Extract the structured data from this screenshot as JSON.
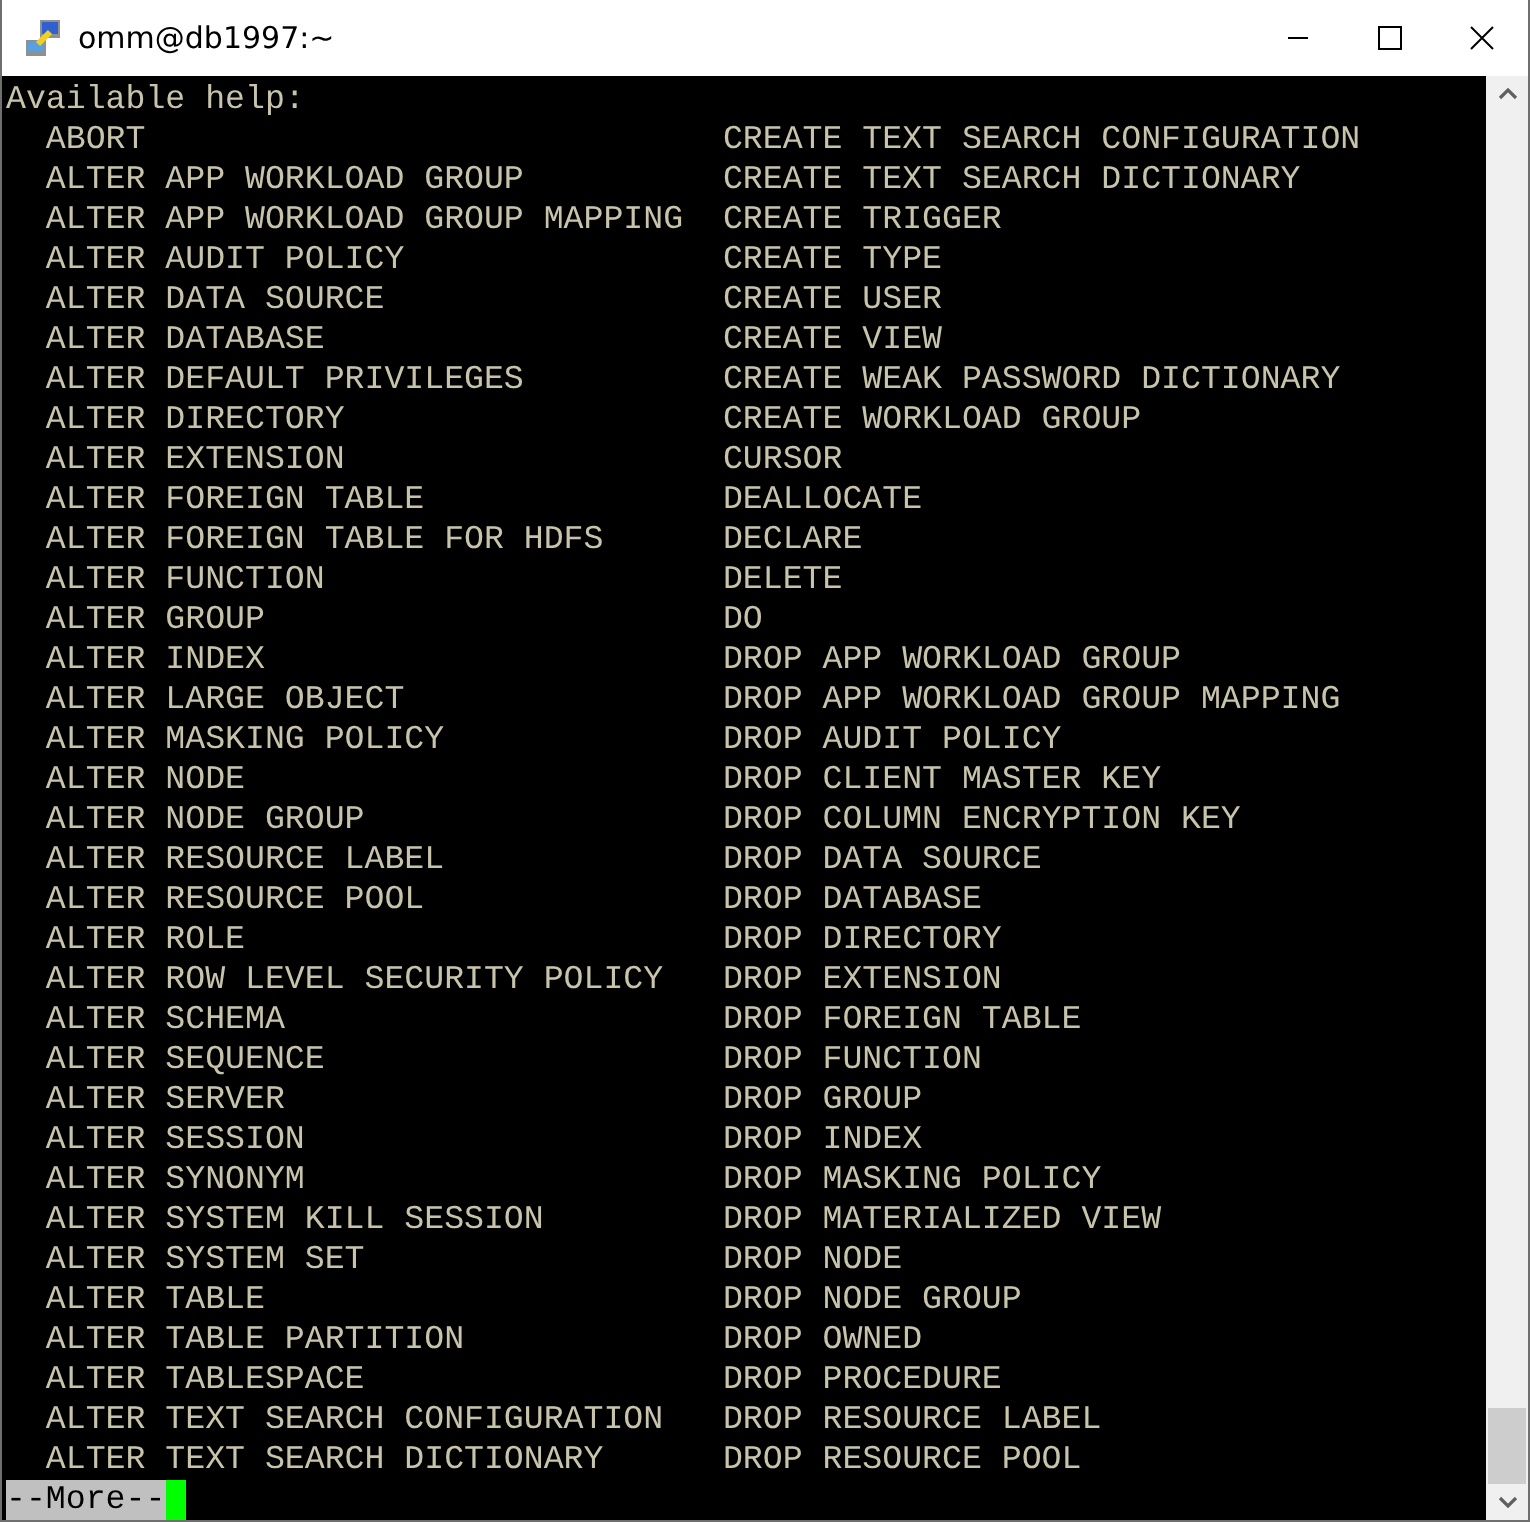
{
  "window": {
    "title": "omm@db1997:~"
  },
  "terminal": {
    "heading": "Available help:",
    "rows": [
      {
        "left": "ABORT",
        "right": "CREATE TEXT SEARCH CONFIGURATION"
      },
      {
        "left": "ALTER APP WORKLOAD GROUP",
        "right": "CREATE TEXT SEARCH DICTIONARY"
      },
      {
        "left": "ALTER APP WORKLOAD GROUP MAPPING",
        "right": "CREATE TRIGGER"
      },
      {
        "left": "ALTER AUDIT POLICY",
        "right": "CREATE TYPE"
      },
      {
        "left": "ALTER DATA SOURCE",
        "right": "CREATE USER"
      },
      {
        "left": "ALTER DATABASE",
        "right": "CREATE VIEW"
      },
      {
        "left": "ALTER DEFAULT PRIVILEGES",
        "right": "CREATE WEAK PASSWORD DICTIONARY"
      },
      {
        "left": "ALTER DIRECTORY",
        "right": "CREATE WORKLOAD GROUP"
      },
      {
        "left": "ALTER EXTENSION",
        "right": "CURSOR"
      },
      {
        "left": "ALTER FOREIGN TABLE",
        "right": "DEALLOCATE"
      },
      {
        "left": "ALTER FOREIGN TABLE FOR HDFS",
        "right": "DECLARE"
      },
      {
        "left": "ALTER FUNCTION",
        "right": "DELETE"
      },
      {
        "left": "ALTER GROUP",
        "right": "DO"
      },
      {
        "left": "ALTER INDEX",
        "right": "DROP APP WORKLOAD GROUP"
      },
      {
        "left": "ALTER LARGE OBJECT",
        "right": "DROP APP WORKLOAD GROUP MAPPING"
      },
      {
        "left": "ALTER MASKING POLICY",
        "right": "DROP AUDIT POLICY"
      },
      {
        "left": "ALTER NODE",
        "right": "DROP CLIENT MASTER KEY"
      },
      {
        "left": "ALTER NODE GROUP",
        "right": "DROP COLUMN ENCRYPTION KEY"
      },
      {
        "left": "ALTER RESOURCE LABEL",
        "right": "DROP DATA SOURCE"
      },
      {
        "left": "ALTER RESOURCE POOL",
        "right": "DROP DATABASE"
      },
      {
        "left": "ALTER ROLE",
        "right": "DROP DIRECTORY"
      },
      {
        "left": "ALTER ROW LEVEL SECURITY POLICY",
        "right": "DROP EXTENSION"
      },
      {
        "left": "ALTER SCHEMA",
        "right": "DROP FOREIGN TABLE"
      },
      {
        "left": "ALTER SEQUENCE",
        "right": "DROP FUNCTION"
      },
      {
        "left": "ALTER SERVER",
        "right": "DROP GROUP"
      },
      {
        "left": "ALTER SESSION",
        "right": "DROP INDEX"
      },
      {
        "left": "ALTER SYNONYM",
        "right": "DROP MASKING POLICY"
      },
      {
        "left": "ALTER SYSTEM KILL SESSION",
        "right": "DROP MATERIALIZED VIEW"
      },
      {
        "left": "ALTER SYSTEM SET",
        "right": "DROP NODE"
      },
      {
        "left": "ALTER TABLE",
        "right": "DROP NODE GROUP"
      },
      {
        "left": "ALTER TABLE PARTITION",
        "right": "DROP OWNED"
      },
      {
        "left": "ALTER TABLESPACE",
        "right": "DROP PROCEDURE"
      },
      {
        "left": "ALTER TEXT SEARCH CONFIGURATION",
        "right": "DROP RESOURCE LABEL"
      },
      {
        "left": "ALTER TEXT SEARCH DICTIONARY",
        "right": "DROP RESOURCE POOL"
      }
    ],
    "pager_prompt": "--More--"
  }
}
